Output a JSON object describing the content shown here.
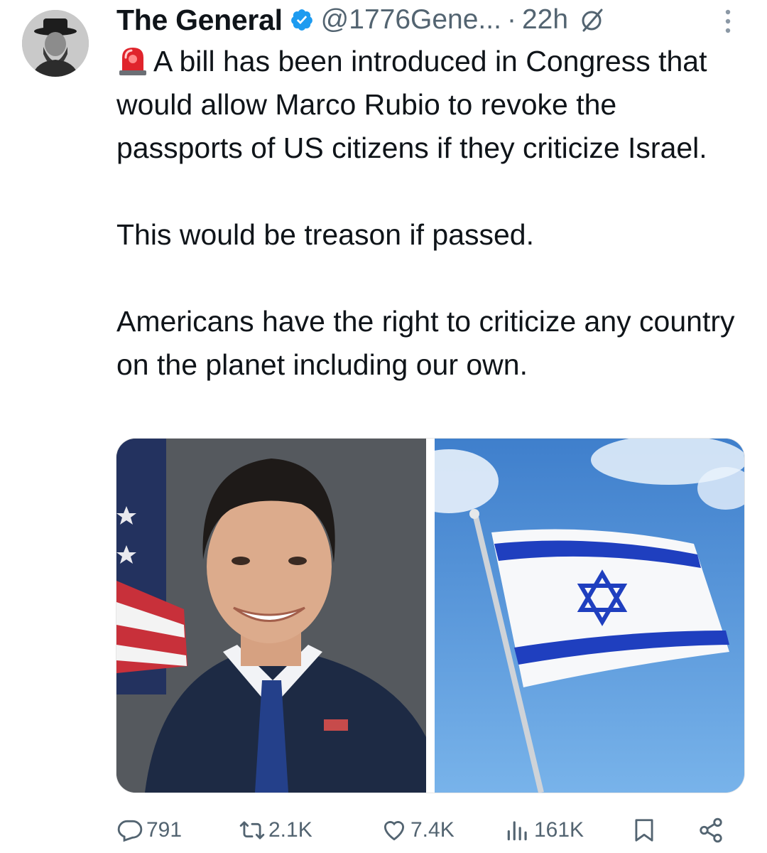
{
  "author": {
    "name": "The General",
    "handle": "@1776Gene...",
    "separator": "·",
    "time": "22h"
  },
  "tweet": {
    "line1": "A bill has been introduced in Congress that would allow Marco Rubio to revoke the passports of US citizens if they criticize Israel.",
    "line2": "This would be treason if passed.",
    "line3": "Americans have the right to criticize any country on the planet including our own."
  },
  "media": {
    "images": [
      "portrait-photo",
      "flag-photo"
    ]
  },
  "actions": {
    "replies": "791",
    "reposts": "2.1K",
    "likes": "7.4K",
    "views": "161K"
  },
  "colors": {
    "text": "#0f1419",
    "muted": "#536471",
    "verified": "#1d9bf0",
    "flag_blue": "#1f3fbf"
  },
  "icons": [
    "verified-badge-icon",
    "grok-icon",
    "more-icon",
    "siren-icon",
    "reply-icon",
    "repost-icon",
    "like-icon",
    "views-icon",
    "bookmark-icon",
    "share-icon"
  ]
}
